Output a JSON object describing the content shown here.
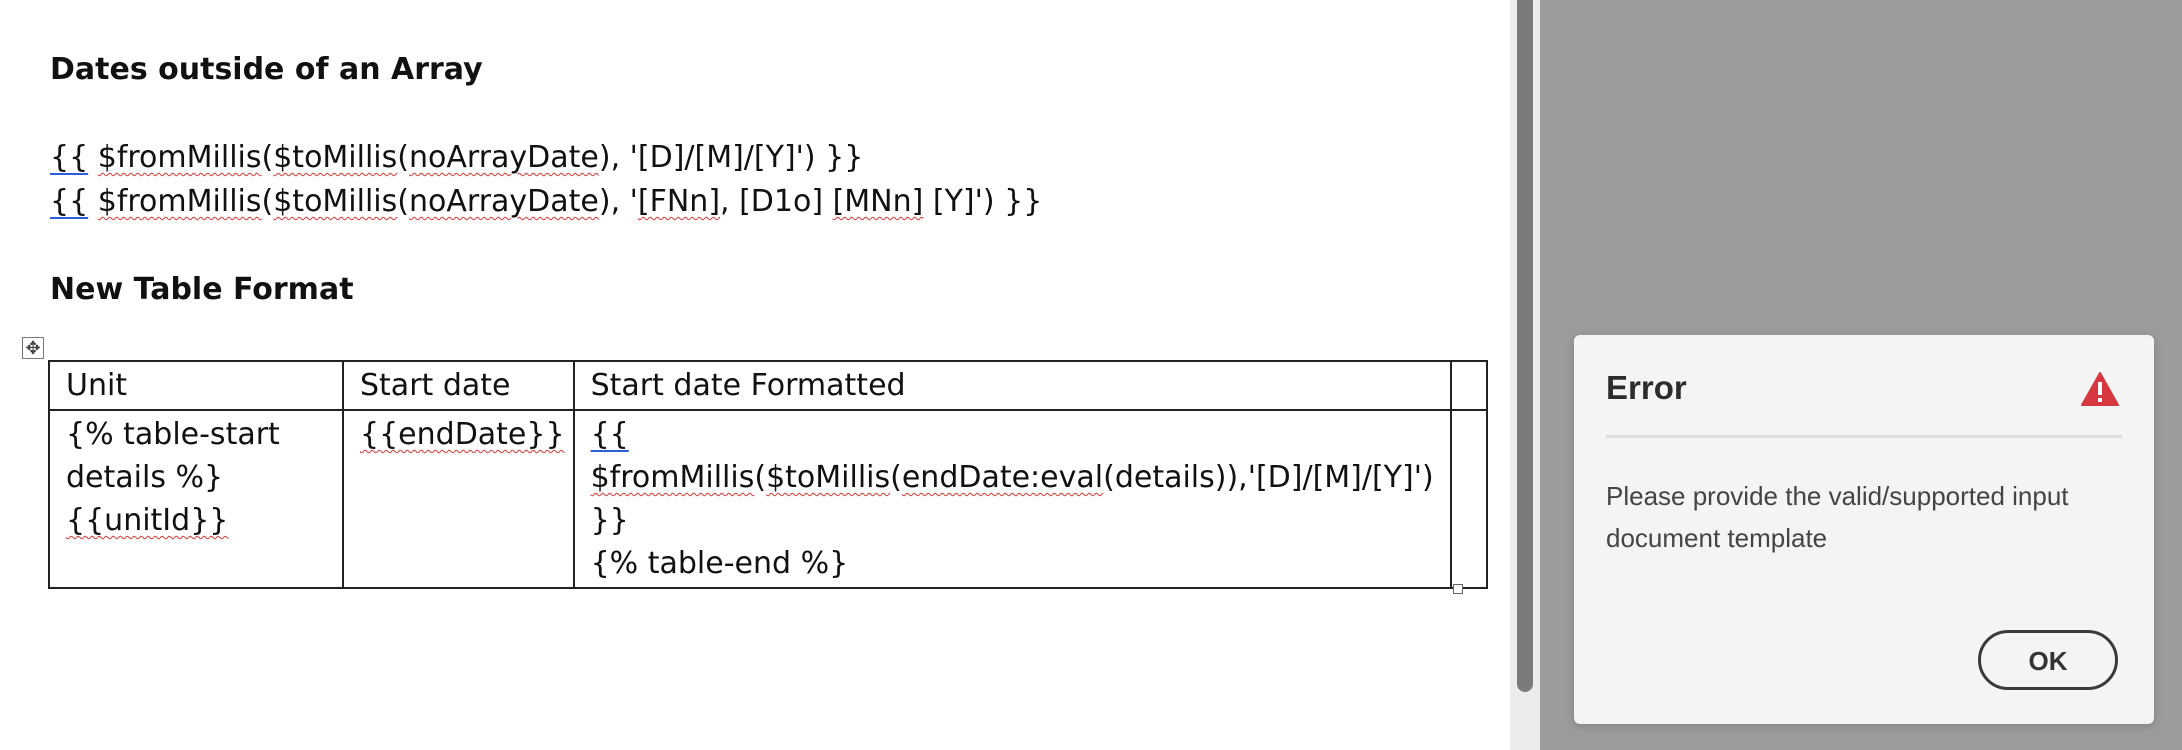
{
  "document": {
    "heading1": "Dates outside of an Array",
    "line1": {
      "open": "{{",
      "fn1": "$fromMillis",
      "p1": "(",
      "fn2": "$toMillis",
      "p2": "(",
      "arg": "noArrayDate",
      "rest": "), '[D]/[M]/[Y]') }}"
    },
    "line2": {
      "open": "{{",
      "fn1": "$fromMillis",
      "p1": "(",
      "fn2": "$toMillis",
      "p2": "(",
      "arg": "noArrayDate",
      "mid1": "), '",
      "fmt1": "[FNn]",
      "mid2": ", [D1o] ",
      "fmt2": "[MNn]",
      "rest": " [Y]') }}"
    },
    "heading2": "New Table Format",
    "table": {
      "headers": [
        "Unit",
        "Start date",
        "Start date Formatted"
      ],
      "row": {
        "unit_line1": "{% table-start",
        "unit_line2": "details %}",
        "unit_line3": "{{unitId}}",
        "start_date": "{{endDate}}",
        "formatted_open": "{{",
        "formatted_fn1": "$fromMillis",
        "formatted_p1": "(",
        "formatted_fn2": "$toMillis",
        "formatted_p2": "(",
        "formatted_arg": "endDate:eval",
        "formatted_rest": "(details)),'[D]/[M]/[Y]')",
        "formatted_close": "}}",
        "formatted_end": "{% table-end %}"
      }
    }
  },
  "dialog": {
    "title": "Error",
    "message": "Please provide the valid/supported input document template",
    "ok_label": "OK",
    "warning_icon": "warning-triangle-icon",
    "warning_color": "#d7373f"
  }
}
